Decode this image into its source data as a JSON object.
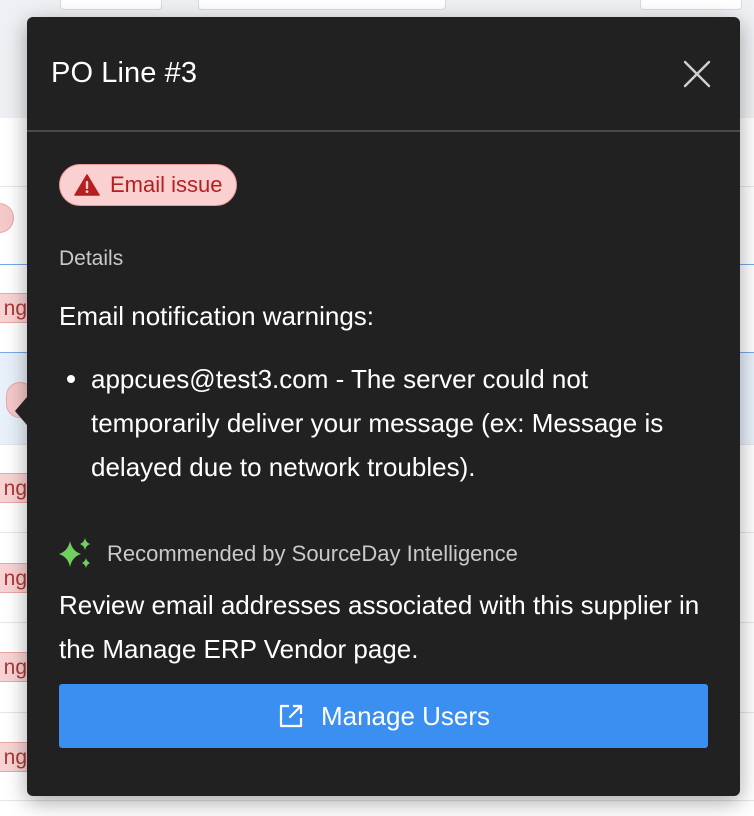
{
  "background": {
    "row_badge_text": "ng"
  },
  "popover": {
    "title": "PO Line #3",
    "close_icon": "close-icon",
    "status": {
      "icon": "warning-icon",
      "label": "Email issue",
      "color": "#b51f1f",
      "bg": "#fbd0d0"
    },
    "details_label": "Details",
    "warnings_heading": "Email notification warnings:",
    "warnings": [
      "appcues@test3.com - The server could not temporarily deliver your message (ex: Message is delayed due to network troubles)."
    ],
    "recommendation": {
      "icon": "sparkles-icon",
      "label": "Recommended by SourceDay Intelligence",
      "text": "Review email addresses associated with this supplier in the Manage ERP Vendor page."
    },
    "action": {
      "icon": "external-link-icon",
      "label": "Manage Users",
      "color": "#3b8ff0"
    }
  }
}
